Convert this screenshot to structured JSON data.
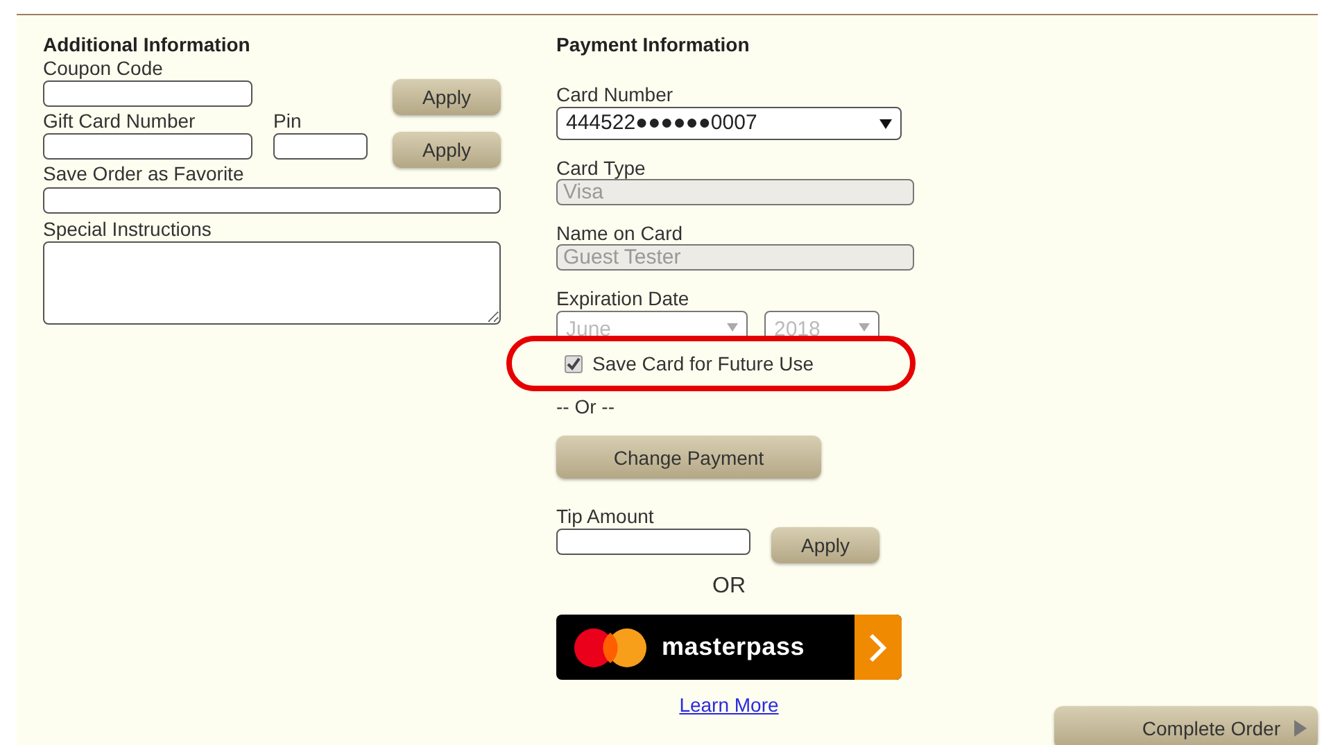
{
  "additional": {
    "title": "Additional Information",
    "coupon": {
      "label": "Coupon Code",
      "button": "Apply"
    },
    "gift_card": {
      "label": "Gift Card Number",
      "pin_label": "Pin",
      "button": "Apply"
    },
    "favorite": {
      "label": "Save Order as Favorite"
    },
    "instructions": {
      "label": "Special Instructions"
    }
  },
  "payment": {
    "title": "Payment Information",
    "card_number": {
      "label": "Card Number",
      "value": "444522●●●●●●0007"
    },
    "card_type": {
      "label": "Card Type",
      "value": "Visa",
      "disabled": true
    },
    "name_on_card": {
      "label": "Name on Card",
      "value": "Guest Tester",
      "disabled": true
    },
    "expiration": {
      "label": "Expiration Date",
      "month": "June",
      "year": "2018",
      "disabled": true
    },
    "save_card": {
      "label": "Save Card for Future Use",
      "checked": true,
      "highlighted": true
    },
    "or_divider": "-- Or --",
    "change_button": "Change Payment",
    "tip": {
      "label": "Tip Amount",
      "button": "Apply"
    },
    "or_text": "OR",
    "masterpass": {
      "label": "masterpass",
      "link": "Learn More"
    }
  },
  "complete_button": "Complete Order"
}
